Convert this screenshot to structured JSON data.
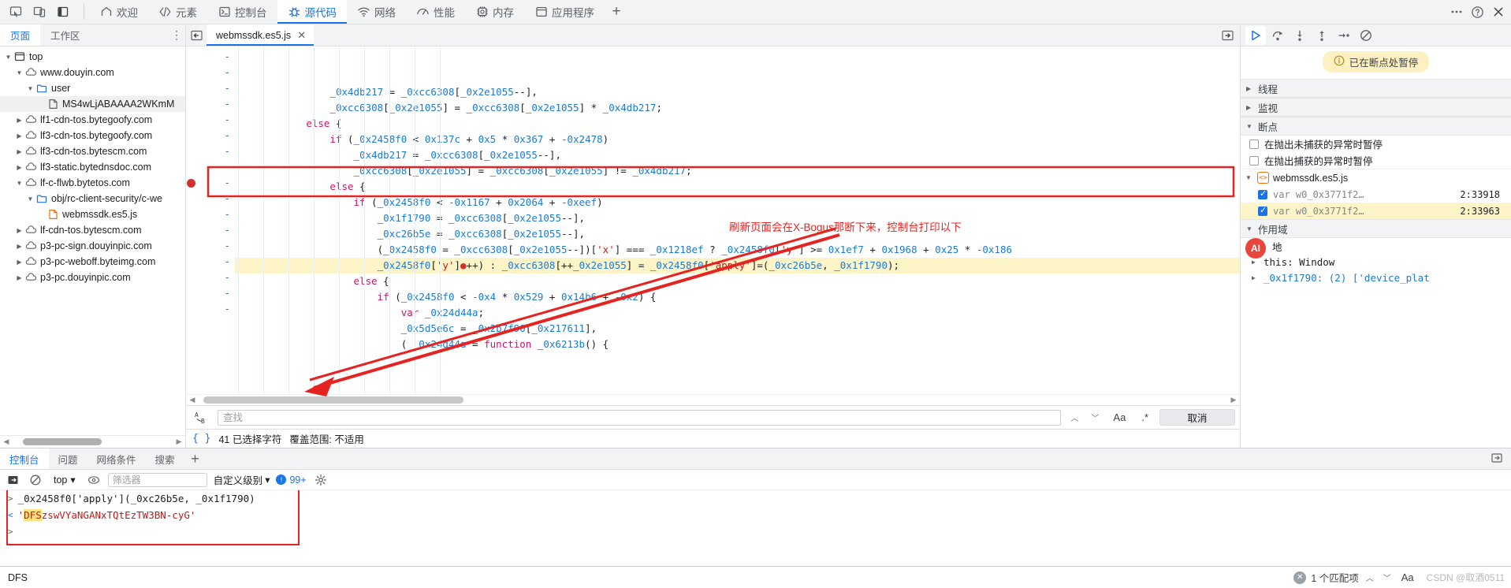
{
  "topbar": {
    "left_icons": [
      "inspect-element-icon",
      "device-toolbar-icon",
      "dock-side-icon"
    ],
    "tabs": [
      {
        "label": "欢迎",
        "icon": "home-icon",
        "active": false
      },
      {
        "label": "元素",
        "icon": "code-brackets-icon",
        "active": false
      },
      {
        "label": "控制台",
        "icon": "console-terminal-icon",
        "active": false
      },
      {
        "label": "源代码",
        "icon": "bug-sources-icon",
        "active": true
      },
      {
        "label": "网络",
        "icon": "network-wifi-icon",
        "active": false
      },
      {
        "label": "性能",
        "icon": "performance-gauge-icon",
        "active": false
      },
      {
        "label": "内存",
        "icon": "memory-chip-icon",
        "active": false
      },
      {
        "label": "应用程序",
        "icon": "application-panel-icon",
        "active": false
      }
    ],
    "add_tab": "+",
    "right_icons": [
      "more-options-icon",
      "help-icon",
      "close-icon"
    ]
  },
  "navigator": {
    "tabs": [
      {
        "label": "页面",
        "active": true
      },
      {
        "label": "工作区",
        "active": false
      }
    ],
    "more": "⋮",
    "tree": [
      {
        "label": "top",
        "depth": 0,
        "icon": "frame-icon",
        "twisty": "open",
        "selected": false
      },
      {
        "label": "www.douyin.com",
        "depth": 1,
        "icon": "cloud-icon",
        "twisty": "open",
        "selected": false
      },
      {
        "label": "user",
        "depth": 2,
        "icon": "folder-icon",
        "twisty": "open",
        "selected": false
      },
      {
        "label": "MS4wLjABAAAA2WKmM",
        "depth": 3,
        "icon": "document-icon",
        "twisty": "none",
        "selected": true
      },
      {
        "label": "lf1-cdn-tos.bytegoofy.com",
        "depth": 1,
        "icon": "cloud-icon",
        "twisty": "closed",
        "selected": false
      },
      {
        "label": "lf3-cdn-tos.bytegoofy.com",
        "depth": 1,
        "icon": "cloud-icon",
        "twisty": "closed",
        "selected": false
      },
      {
        "label": "lf3-cdn-tos.bytescm.com",
        "depth": 1,
        "icon": "cloud-icon",
        "twisty": "closed",
        "selected": false
      },
      {
        "label": "lf3-static.bytednsdoc.com",
        "depth": 1,
        "icon": "cloud-icon",
        "twisty": "closed",
        "selected": false
      },
      {
        "label": "lf-c-flwb.bytetos.com",
        "depth": 1,
        "icon": "cloud-icon",
        "twisty": "open",
        "selected": false
      },
      {
        "label": "obj/rc-client-security/c-we",
        "depth": 2,
        "icon": "folder-icon",
        "twisty": "open",
        "selected": false
      },
      {
        "label": "webmssdk.es5.js",
        "depth": 3,
        "icon": "js-file-icon",
        "twisty": "none",
        "selected": false
      },
      {
        "label": "lf-cdn-tos.bytescm.com",
        "depth": 1,
        "icon": "cloud-icon",
        "twisty": "closed",
        "selected": false
      },
      {
        "label": "p3-pc-sign.douyinpic.com",
        "depth": 1,
        "icon": "cloud-icon",
        "twisty": "closed",
        "selected": false
      },
      {
        "label": "p3-pc-weboff.byteimg.com",
        "depth": 1,
        "icon": "cloud-icon",
        "twisty": "closed",
        "selected": false
      },
      {
        "label": "p3-pc.douyinpic.com",
        "depth": 1,
        "icon": "cloud-icon",
        "twisty": "closed",
        "selected": false
      }
    ]
  },
  "editor": {
    "back_icon": "navigate-back-icon",
    "tab_label": "webmssdk.es5.js",
    "tab_close": "✕",
    "show_drawer_icon": "show-navigator-icon",
    "gutter_marks": [
      "-",
      "-",
      "-",
      "-",
      "-",
      "-",
      "-",
      "-",
      "-",
      "-",
      "-",
      "-",
      "-"
    ],
    "lines": [
      "                _0x4db217 = _0xcc6308[_0x2e1055--],",
      "                _0xcc6308[_0x2e1055] = _0xcc6308[_0x2e1055] * _0x4db217;",
      "            else {",
      "                if (_0x2458f0 < 0x137c + 0x5 * 0x367 + -0x2478)",
      "                    _0x4db217 = _0xcc6308[_0x2e1055--],",
      "                    _0xcc6308[_0x2e1055] = _0xcc6308[_0x2e1055] != _0x4db217;",
      "                else {",
      "                    if (_0x2458f0 < -0x1167 + 0x2064 + -0xeef)",
      "                        _0x1f1790 = _0xcc6308[_0x2e1055--],",
      "                        _0xc26b5e = _0xcc6308[_0x2e1055--],",
      "                        (_0x2458f0 = _0xcc6308[_0x2e1055--])['x'] === _0x1218ef ? _0x2458f0['y'] >= 0x1ef7 + 0x1968 + 0x25 * -0x186",
      "                        _0x2458f0['y']●++) : _0xcc6308[++_0x2e1055] = _0x2458f0['apply']=(_0xc26b5e, _0x1f1790);",
      "                    else {",
      "                        if (_0x2458f0 < -0x4 * 0x529 + 0x14b6 + -0x2) {",
      "                            var _0x24d44a;",
      "                            _0x5d5e6c = _0x2b7f90[_0x217611],",
      "                            ( _0x24d44a = function _0x6213b() {"
    ],
    "find": {
      "placeholder": "查找",
      "value": "",
      "prev_icon": "chevron-up-icon",
      "next_icon": "chevron-down-icon",
      "match_case_label": "Aa",
      "regex_label": ".*",
      "cancel_label": "取消",
      "ab_icon": "replace-icon"
    },
    "status": {
      "brace_icon": "{ }",
      "selection_text": "41 已选择字符",
      "coverage_text": "覆盖范围: 不适用"
    }
  },
  "debugger": {
    "toolbar_icons": [
      "resume-script-icon",
      "step-over-icon",
      "step-into-icon",
      "step-out-icon",
      "step-icon",
      "deactivate-breakpoints-icon"
    ],
    "pause_banner": {
      "icon": "info-icon",
      "text": "已在断点处暂停"
    },
    "sections": [
      {
        "label": "线程",
        "open": false
      },
      {
        "label": "监视",
        "open": false
      },
      {
        "label": "断点",
        "open": true
      }
    ],
    "breakpoint_options": [
      {
        "label": "在抛出未捕获的异常时暂停",
        "checked": false
      },
      {
        "label": "在抛出捕获的异常时暂停",
        "checked": false
      }
    ],
    "breakpoint_file": {
      "name": "webmssdk.es5.js",
      "icon": "js-file-icon"
    },
    "breakpoints": [
      {
        "code": "var w0_0x3771f2…",
        "location": "2:33918",
        "checked": true,
        "selected": false
      },
      {
        "code": "var w0_0x3771f2…",
        "location": "2:33963",
        "checked": true,
        "selected": true
      }
    ],
    "scope": {
      "label": "作用域",
      "rows": [
        {
          "text": "地",
          "kind": "plain"
        },
        {
          "text": "this: Window",
          "kind": "mono"
        },
        {
          "text": "_0x1f1790: (2) ['device_plat",
          "kind": "mono"
        }
      ]
    },
    "ai_badge": "AI"
  },
  "drawer": {
    "tabs": [
      {
        "label": "控制台",
        "active": true
      },
      {
        "label": "问题",
        "active": false
      },
      {
        "label": "网络条件",
        "active": false
      },
      {
        "label": "搜索",
        "active": false
      }
    ],
    "add_tab": "+",
    "right_icons": [
      "drawer-settings-icon",
      "drawer-close-icon"
    ],
    "toolbar": {
      "clear_icon": "clear-console-icon",
      "no_icon": "ban-icon",
      "context": "top",
      "context_caret": "▾",
      "eye_icon": "live-expression-icon",
      "filter_placeholder": "筛选器",
      "filter_value": "",
      "level_label": "自定义级别",
      "level_caret": "▾",
      "issues_count": "99+",
      "settings_icon": "gear-icon"
    },
    "console_lines": [
      {
        "prompt": "input",
        "text": "_0x2458f0['apply'](_0xc26b5e, _0x1f1790)"
      },
      {
        "prompt": "output",
        "text": "'DFSzswVYaNGANxTQtEzTW3BN-cyG'",
        "match": "DFS"
      },
      {
        "prompt": "input",
        "text": ""
      }
    ]
  },
  "bottombar": {
    "value": "DFS",
    "clear_icon": "clear-input-icon",
    "match_count": "1 个匹配项",
    "prev_icon": "chevron-up-icon",
    "next_icon": "chevron-down-icon",
    "match_case_label": "Aa",
    "watermark": "CSDN @取酒0511"
  },
  "annotations": {
    "editor_note": "刷新页面会在X-Bogus那断下来，控制台打印以下",
    "accent_red": "#e52421",
    "highlight_yellow": "#fdf4c8",
    "selection_blue": "#cfe3f7"
  }
}
